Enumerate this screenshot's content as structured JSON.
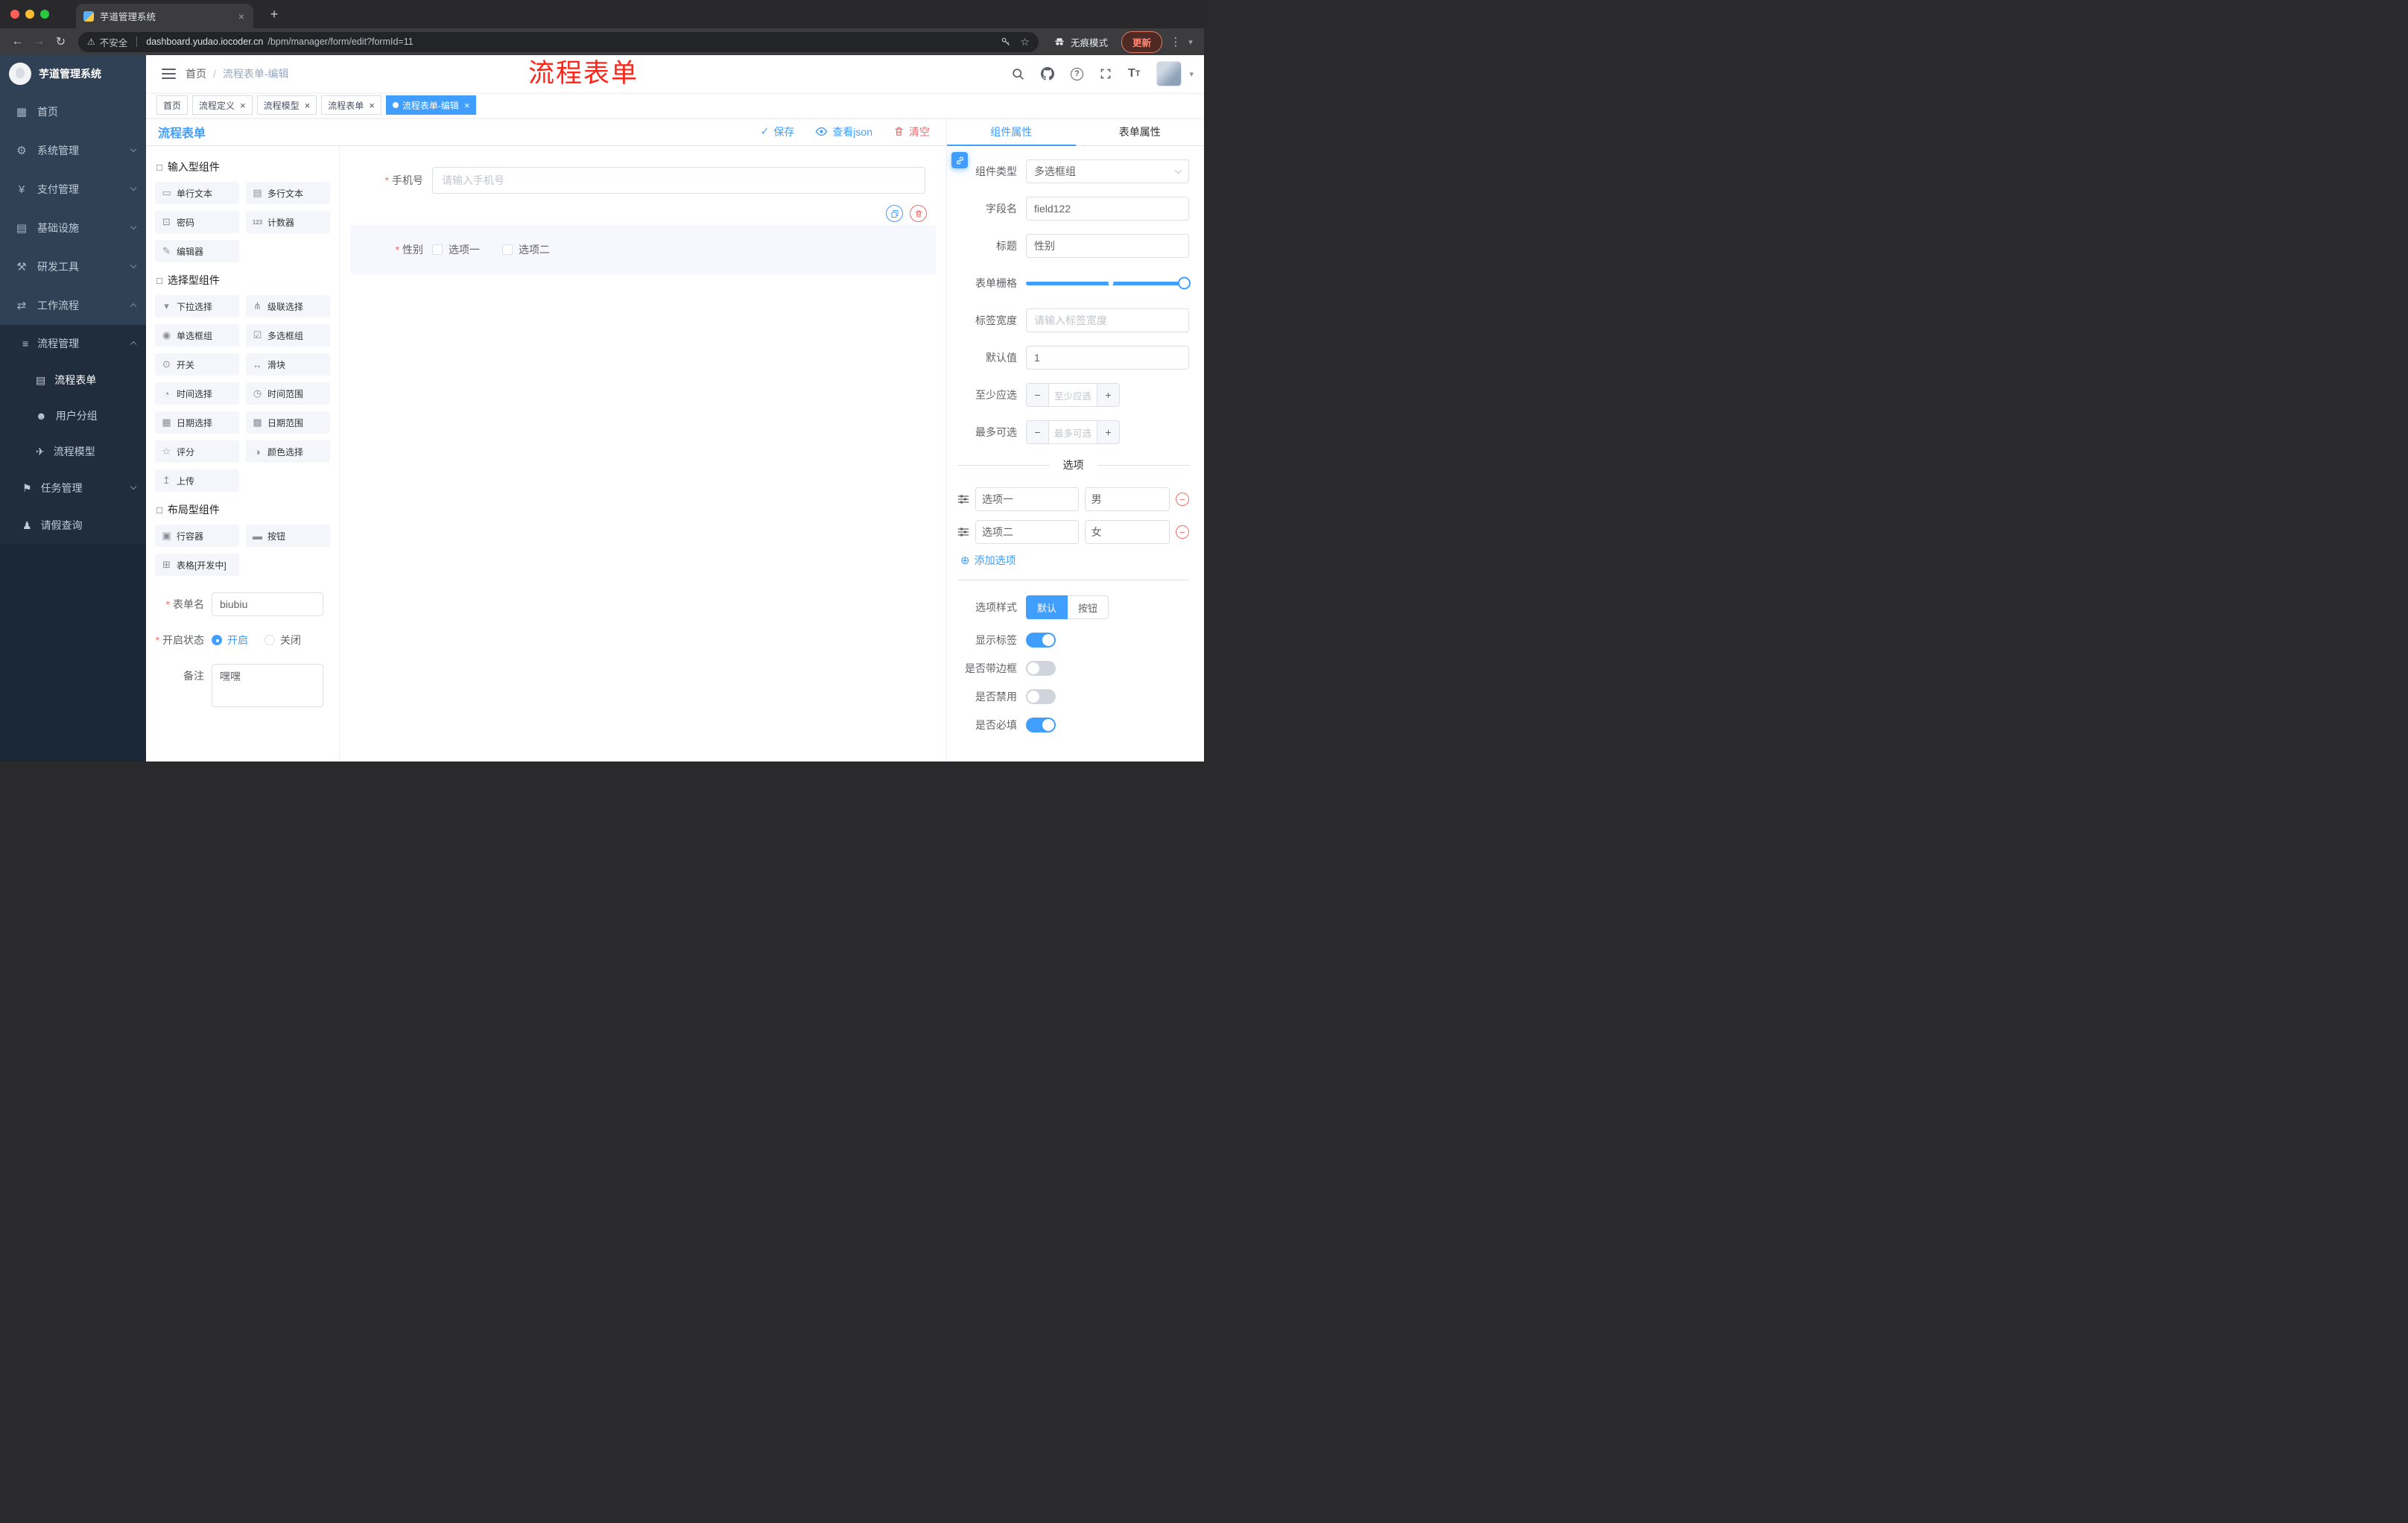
{
  "icons": {
    "close-icon": "×",
    "new-tab-icon": "+",
    "back-icon": "←",
    "forward-icon": "→",
    "reload-icon": "↻",
    "warning-icon": "⚠",
    "star-icon": "☆",
    "kebab-icon": "⋮",
    "caret-down-icon": "▾",
    "check-icon": "✓",
    "add-circle-icon": "⊕",
    "minus-icon": "−",
    "plus-icon": "+",
    "home-icon": "▦",
    "system-icon": "⚙",
    "payment-icon": "¥",
    "infrastructure-icon": "▤",
    "devtools-icon": "⚒",
    "workflow-icon": "⇄",
    "process-management-icon": "≡",
    "process-form-icon": "▤",
    "user-group-icon": "☻",
    "process-model-icon": "✈",
    "task-management-icon": "⚑",
    "leave-query-icon": "♟",
    "component-group-icon": "□",
    "single-line-text-icon": "▭",
    "multi-line-text-icon": "▤",
    "password-icon": "⊡",
    "counter-icon": "123",
    "editor-icon": "✎",
    "select-icon": "▾",
    "cascader-icon": "⋔",
    "radio-group-icon": "◉",
    "checkbox-group-icon": "☑",
    "switch-icon": "⊙",
    "slider-icon": "↔",
    "time-picker-icon": "◔",
    "time-range-icon": "◷",
    "date-picker-icon": "▦",
    "date-range-icon": "▩",
    "rate-icon": "☆",
    "color-picker-icon": "◑",
    "upload-icon": "↥",
    "row-container-icon": "▣",
    "button-icon": "▬",
    "table-icon": "⊞"
  },
  "browser": {
    "tab_title": "芋道管理系统",
    "security_label": "不安全",
    "url_domain": "dashboard.yudao.iocoder.cn",
    "url_path": "/bpm/manager/form/edit?formId=11",
    "incognito_label": "无痕模式",
    "update_label": "更新"
  },
  "sidebar": {
    "logo_title": "芋道管理系统",
    "items": [
      {
        "label": "首页"
      },
      {
        "label": "系统管理"
      },
      {
        "label": "支付管理"
      },
      {
        "label": "基础设施"
      },
      {
        "label": "研发工具"
      },
      {
        "label": "工作流程"
      }
    ],
    "workflow": {
      "process_management": "流程管理",
      "process_children": [
        {
          "label": "流程表单"
        },
        {
          "label": "用户分组"
        },
        {
          "label": "流程模型"
        }
      ],
      "task_management": "任务管理",
      "leave_query": "请假查询"
    }
  },
  "navbar": {
    "breadcrumb_root": "首页",
    "breadcrumb_sep": "/",
    "breadcrumb_current": "流程表单-编辑",
    "annotation": "流程表单"
  },
  "tags": {
    "items": [
      {
        "label": "首页",
        "closable": false,
        "active": false
      },
      {
        "label": "流程定义",
        "closable": true,
        "active": false
      },
      {
        "label": "流程模型",
        "closable": true,
        "active": false
      },
      {
        "label": "流程表单",
        "closable": true,
        "active": false
      },
      {
        "label": "流程表单-编辑",
        "closable": true,
        "active": true
      }
    ]
  },
  "designer": {
    "title": "流程表单",
    "actions": {
      "save": "保存",
      "view_json": "查看json",
      "clear": "清空"
    },
    "palette": [
      {
        "title": "输入型组件",
        "items": [
          "单行文本",
          "多行文本",
          "密码",
          "计数器",
          "编辑器"
        ]
      },
      {
        "title": "选择型组件",
        "items": [
          "下拉选择",
          "级联选择",
          "单选框组",
          "多选框组",
          "开关",
          "滑块",
          "时间选择",
          "时间范围",
          "日期选择",
          "日期范围",
          "评分",
          "颜色选择",
          "上传"
        ]
      },
      {
        "title": "布局型组件",
        "items": [
          "行容器",
          "按钮",
          "表格[开发中]"
        ]
      }
    ],
    "meta": {
      "name_label": "表单名",
      "name_value": "biubiu",
      "status_label": "开启状态",
      "status_on": "开启",
      "status_off": "关闭",
      "status_value": "开启",
      "remark_label": "备注",
      "remark_value": "嘿嘿"
    },
    "canvas": {
      "phone": {
        "label": "手机号",
        "required": true,
        "placeholder": "请输入手机号"
      },
      "gender": {
        "label": "性别",
        "required": true,
        "selected": true,
        "options": [
          {
            "label": "选项一"
          },
          {
            "label": "选项二"
          }
        ]
      }
    }
  },
  "properties": {
    "tabs": [
      {
        "label": "组件属性",
        "active": true
      },
      {
        "label": "表单属性",
        "active": false
      }
    ],
    "component_type": {
      "label": "组件类型",
      "value": "多选框组"
    },
    "field_name": {
      "label": "字段名",
      "value": "field122"
    },
    "title": {
      "label": "标题",
      "value": "性别"
    },
    "form_grid": {
      "label": "表单栅格",
      "value": 24,
      "max": 24
    },
    "label_width": {
      "label": "标签宽度",
      "placeholder": "请输入标签宽度"
    },
    "default_value": {
      "label": "默认值",
      "value": "1"
    },
    "min_select": {
      "label": "至少应选",
      "placeholder": "至少应选"
    },
    "max_select": {
      "label": "最多可选",
      "placeholder": "最多可选"
    },
    "options_title": "选项",
    "options": [
      {
        "name": "选项一",
        "value": "男"
      },
      {
        "name": "选项二",
        "value": "女"
      }
    ],
    "add_option_label": "添加选项",
    "option_style": {
      "label": "选项样式",
      "choices": [
        "默认",
        "按钮"
      ],
      "value": "默认"
    },
    "show_label": {
      "label": "显示标签",
      "value": true
    },
    "with_border": {
      "label": "是否带边框",
      "value": false
    },
    "disabled": {
      "label": "是否禁用",
      "value": false
    },
    "required": {
      "label": "是否必填",
      "value": true
    }
  }
}
